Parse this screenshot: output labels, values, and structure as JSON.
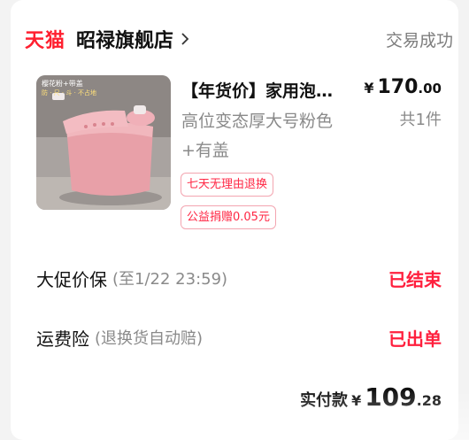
{
  "header": {
    "brand": "天猫",
    "store_name": "昭禄旗舰店",
    "status": "交易成功"
  },
  "item": {
    "image_labels": {
      "color": "樱花粉+带盖",
      "feature": "防 · 尺 · 斗 · 不占地"
    },
    "title": "【年货价】家用泡澡桶",
    "variant": "高位变态厚大号粉色+有盖",
    "price": {
      "currency": "¥",
      "integer": "170",
      "decimal": ".00"
    },
    "quantity": "共1件",
    "tags": [
      "七天无理由退换",
      "公益捐赠0.05元"
    ]
  },
  "services": [
    {
      "label": "大促价保",
      "sub": "(至1/22 23:59)",
      "value": "已结束"
    },
    {
      "label": "运费险",
      "sub": "(退换货自动赔)",
      "value": "已出单"
    }
  ],
  "total": {
    "label": "实付款",
    "currency": "¥",
    "integer": "109",
    "decimal": ".28"
  },
  "colors": {
    "brand_red": "#ff1f2f",
    "tag_red": "#ff2744",
    "muted": "#8a8a8a",
    "product_pink": "#e8a0a8"
  }
}
